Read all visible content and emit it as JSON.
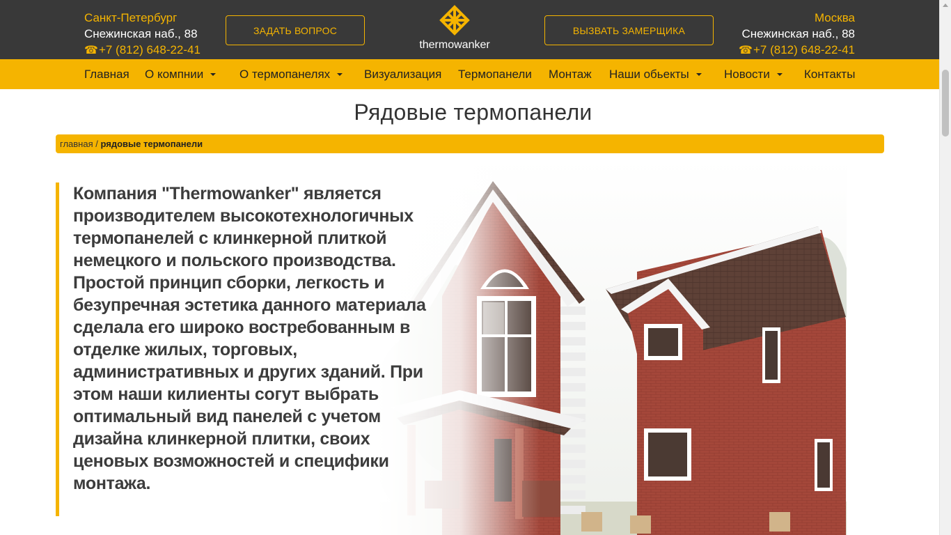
{
  "header": {
    "left_city": {
      "name": "Санкт-Петербург",
      "address": "Снежинская наб., 88",
      "phone": "+7 (812) 648-22-41"
    },
    "right_city": {
      "name": "Москва",
      "address": "Снежинская наб., 88",
      "phone": "+7 (812) 648-22-41"
    },
    "ask_button": "ЗАДАТЬ ВОПРОС",
    "measure_button": "ВЫЗВАТЬ ЗАМЕРЩИКА",
    "logo_text": "thermowanker"
  },
  "nav": {
    "items": [
      {
        "label": "Главная",
        "dropdown": false
      },
      {
        "label": "О компнии",
        "dropdown": true
      },
      {
        "label": "О термопанелях",
        "dropdown": true
      },
      {
        "label": "Визуализация",
        "dropdown": false
      },
      {
        "label": "Термопанели",
        "dropdown": false
      },
      {
        "label": "Монтаж",
        "dropdown": false
      },
      {
        "label": "Наши обьекты",
        "dropdown": true
      },
      {
        "label": "Новости",
        "dropdown": true
      },
      {
        "label": "Контакты",
        "dropdown": false
      }
    ]
  },
  "page_title": "Рядовые термопанели",
  "breadcrumb": {
    "home": "главная",
    "separator": " / ",
    "current": "рядовые термопанели"
  },
  "hero": {
    "text": "Компания \"Thermowanker\" является производителем высокотехнологичных термопанелей с клинкерной плиткой немецкого и польского производства. Простой принцип сборки, легкость и безупречная эстетика данного материала сделала его широко востребованным в отделке жилых, торговых, административных и других зданий. При этом наши килиенты согут выбрать оптимальный вид панелей с учетом дизайна клинкерной плитки, своих ценовых возможностей и специфики монтажа."
  },
  "colors": {
    "accent": "#f5b400",
    "header_bg": "#393939",
    "text_dark": "#3c3c3c"
  },
  "icons": [
    "phone-icon",
    "logo-icon",
    "caret-down-icon"
  ]
}
